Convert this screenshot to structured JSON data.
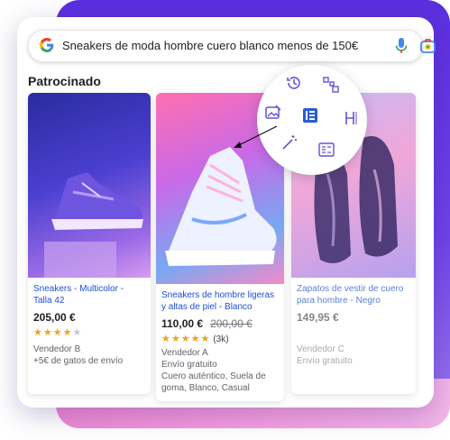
{
  "search": {
    "query": "Sneakers de moda hombre cuero blanco menos de 150€"
  },
  "section_title": "Patrocinado",
  "products": [
    {
      "title_line1": "Sneakers - Multicolor -",
      "title_line2": "Talla 42",
      "price": "205,00 €",
      "old_price": "",
      "rating": 4,
      "rating_count": "",
      "seller": "Vendedor B",
      "meta_lines": [
        "+5€ de gatos de envío"
      ]
    },
    {
      "title_line1": "Sneakers de hombre ligeras",
      "title_line2": "y altas de piel - Blanco",
      "price": "110,00 €",
      "old_price": "200,00 €",
      "rating": 5,
      "rating_count": "(3k)",
      "seller": "Vendedor A",
      "meta_lines": [
        "Envío gratuito",
        "Cuero auténtico, Suela de",
        "goma, Blanco, Casual"
      ]
    },
    {
      "title_line1": "Zapatos de vestir de cuero",
      "title_line2": "para hombre - Negro",
      "price": "149,95 €",
      "old_price": "",
      "rating": 0,
      "rating_count": "",
      "seller": "Vendedor C",
      "meta_lines": [
        "Envío gratuito"
      ]
    }
  ],
  "icons": {
    "search": "google-g-icon",
    "voice": "mic-icon",
    "visual_search": "camera-icon",
    "overlay": [
      "history-icon",
      "layout-grid-icon",
      "image-edit-icon",
      "data-block-icon",
      "heading-icon",
      "magic-wand-icon",
      "layout-list-icon"
    ]
  },
  "colors": {
    "backdrop_purple": "#5b2fe0",
    "backdrop_pink": "#f08ad6",
    "link_blue": "#1a4fd6",
    "star": "#f4a21a",
    "overlay_icon": "#6a4fd8"
  }
}
